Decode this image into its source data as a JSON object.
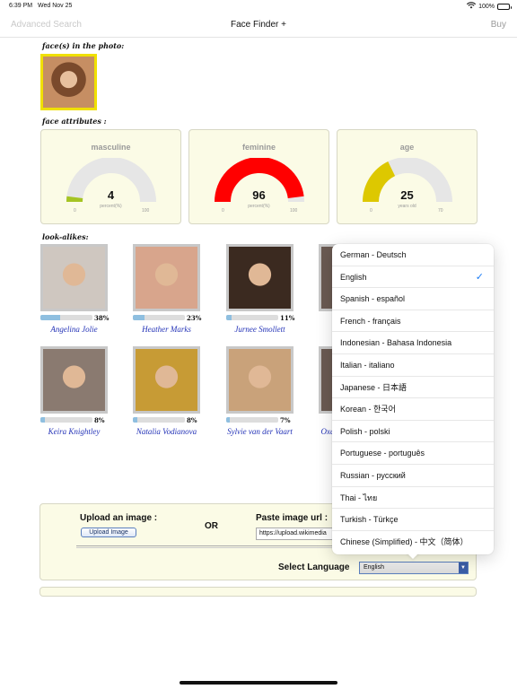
{
  "status_bar": {
    "time": "6:39 PM",
    "date": "Wed Nov 25",
    "battery": "100%"
  },
  "nav": {
    "left": "Advanced Search",
    "title": "Face Finder +",
    "right": "Buy"
  },
  "sections": {
    "faces_in_photo": "face(s) in the photo:",
    "face_attributes": "face attributes :",
    "look_alikes": "look-alikes:"
  },
  "gauges": [
    {
      "label": "masculine",
      "value": "4",
      "fraction": 0.04,
      "unit": "percent(%)",
      "min": "0",
      "max": "100",
      "color": "#a5c423"
    },
    {
      "label": "feminine",
      "value": "96",
      "fraction": 0.96,
      "unit": "percent(%)",
      "min": "0",
      "max": "100",
      "color": "#ff0000"
    },
    {
      "label": "age",
      "value": "25",
      "fraction": 0.357,
      "unit": "years old",
      "min": "0",
      "max": "70",
      "color": "#ddc800"
    }
  ],
  "lookalikes": [
    {
      "name": "Angelina Jolie",
      "pct": "38%",
      "fraction": 0.38,
      "bg": "#cfc7c0"
    },
    {
      "name": "Heather Marks",
      "pct": "23%",
      "fraction": 0.23,
      "bg": "#d8a58c"
    },
    {
      "name": "Jurnee Smollett",
      "pct": "11%",
      "fraction": 0.11,
      "bg": "#3b2a20"
    },
    {
      "name": "Keira Knightley",
      "pct": "8%",
      "fraction": 0.08,
      "bg": "#8a7a70"
    },
    {
      "name": "Natalia Vodianova",
      "pct": "8%",
      "fraction": 0.08,
      "bg": "#c79b35"
    },
    {
      "name": "Sylvie van der Vaart",
      "pct": "7%",
      "fraction": 0.07,
      "bg": "#c9a27a"
    },
    {
      "name": "Oxa",
      "pct": "",
      "fraction": 0,
      "bg": "#6a5a52"
    }
  ],
  "upload": {
    "upload_title": "Upload an image :",
    "upload_button": "Upload Image",
    "or": "OR",
    "paste_title": "Paste image url :",
    "url_value": "https://upload.wikimedia",
    "select_language_label": "Select Language",
    "selected_language": "English"
  },
  "languages": [
    "German - Deutsch",
    "English",
    "Spanish - español",
    "French - français",
    "Indonesian - Bahasa Indonesia",
    "Italian - italiano",
    "Japanese - 日本語",
    "Korean - 한국어",
    "Polish - polski",
    "Portuguese - português",
    "Russian - русский",
    "Thai - ไทย",
    "Turkish - Türkçe",
    "Chinese (Simplified) - 中文（简体）"
  ],
  "selected_language_index": 1,
  "colors": {
    "accent": "#1a7cf5",
    "panel_bg": "#fbfbe6",
    "name_link": "#2433b7",
    "query_border": "#f0e000"
  }
}
